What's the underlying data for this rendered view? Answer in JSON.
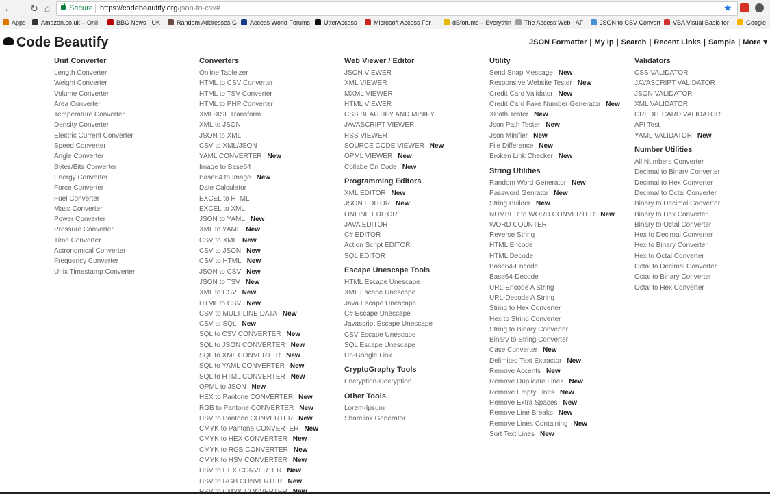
{
  "browser": {
    "secure_label": "Secure",
    "url_host": "https://codebeautify.org",
    "url_path": "/json-to-csv#",
    "bookmarks": [
      {
        "label": "Apps",
        "color": "#e37400"
      },
      {
        "label": "Amazon.co.uk – Onli",
        "color": "#333333"
      },
      {
        "label": "BBC News - UK",
        "color": "#b80000"
      },
      {
        "label": "Random Addresses G",
        "color": "#6d4c41"
      },
      {
        "label": "Access World Forums",
        "color": "#1a3a8a"
      },
      {
        "label": "UtterAccess",
        "color": "#0f0f0f"
      },
      {
        "label": "Microsoft Access For",
        "color": "#c62828"
      },
      {
        "label": "dBforums – Everythin",
        "color": "#e6b800"
      },
      {
        "label": "The Access Web - AF",
        "color": "#9e9e9e"
      },
      {
        "label": "JSON to CSV Convert",
        "color": "#4a90d9"
      },
      {
        "label": "VBA Visual Basic for",
        "color": "#d32f2f"
      },
      {
        "label": "Google",
        "color": "#f4b400"
      }
    ]
  },
  "header": {
    "logo": "Code Beautify",
    "nav": [
      "JSON Formatter",
      "My Ip",
      "Search",
      "Recent Links",
      "Sample",
      "More"
    ]
  },
  "new_badge": "New",
  "columns": [
    {
      "sections": [
        {
          "title": "Unit Converter",
          "items": [
            {
              "label": "Length Converter"
            },
            {
              "label": "Weight Converter"
            },
            {
              "label": "Volume Converter"
            },
            {
              "label": "Area Converter"
            },
            {
              "label": "Temperature Converter"
            },
            {
              "label": "Density Converter"
            },
            {
              "label": "Electric Current Converter"
            },
            {
              "label": "Speed Converter"
            },
            {
              "label": "Angle Converter"
            },
            {
              "label": "Bytes/Bits Converter"
            },
            {
              "label": "Energy Converter"
            },
            {
              "label": "Force Converter"
            },
            {
              "label": "Fuel Converter"
            },
            {
              "label": "Mass Converter"
            },
            {
              "label": "Power Converter"
            },
            {
              "label": "Pressure Converter"
            },
            {
              "label": "Time Converter"
            },
            {
              "label": "Astronomical Converter"
            },
            {
              "label": "Frequency Converter"
            },
            {
              "label": "Unix Timestamp Converter"
            }
          ]
        }
      ]
    },
    {
      "sections": [
        {
          "title": "Converters",
          "items": [
            {
              "label": "Online Tableizer"
            },
            {
              "label": "HTML to CSV Converter"
            },
            {
              "label": "HTML to TSV Converter"
            },
            {
              "label": "HTML to PHP Converter"
            },
            {
              "label": "XML-XSL Transform"
            },
            {
              "label": "XML to JSON"
            },
            {
              "label": "JSON to XML"
            },
            {
              "label": "CSV to XML/JSON"
            },
            {
              "label": "YAML CONVERTER",
              "new": true
            },
            {
              "label": "Image to Base64"
            },
            {
              "label": "Base64 to Image",
              "new": true
            },
            {
              "label": "Date Calculator"
            },
            {
              "label": "EXCEL to HTML"
            },
            {
              "label": "EXCEL to XML"
            },
            {
              "label": "JSON to YAML",
              "new": true
            },
            {
              "label": "XML to YAML",
              "new": true
            },
            {
              "label": "CSV to XML",
              "new": true
            },
            {
              "label": "CSV to JSON",
              "new": true
            },
            {
              "label": "CSV to HTML",
              "new": true
            },
            {
              "label": "JSON to CSV",
              "new": true
            },
            {
              "label": "JSON to TSV",
              "new": true
            },
            {
              "label": "XML to CSV",
              "new": true
            },
            {
              "label": "HTML to CSV",
              "new": true
            },
            {
              "label": "CSV to MULTILINE DATA",
              "new": true
            },
            {
              "label": "CSV to SQL",
              "new": true
            },
            {
              "label": "SQL to CSV CONVERTER",
              "new": true
            },
            {
              "label": "SQL to JSON CONVERTER",
              "new": true
            },
            {
              "label": "SQL to XML CONVERTER",
              "new": true
            },
            {
              "label": "SQL to YAML CONVERTER",
              "new": true
            },
            {
              "label": "SQL to HTML CONVERTER",
              "new": true
            },
            {
              "label": "OPML to JSON",
              "new": true
            },
            {
              "label": "HEX to Pantone CONVERTER",
              "new": true
            },
            {
              "label": "RGB to Pantone CONVERTER",
              "new": true
            },
            {
              "label": "HSV to Pantone CONVERTER",
              "new": true
            },
            {
              "label": "CMYK to Pantone CONVERTER",
              "new": true
            },
            {
              "label": "CMYK to HEX CONVERTER",
              "new": true
            },
            {
              "label": "CMYK to RGB CONVERTER",
              "new": true
            },
            {
              "label": "CMYK to HSV CONVERTER",
              "new": true
            },
            {
              "label": "HSV to HEX CONVERTER",
              "new": true
            },
            {
              "label": "HSV to RGB CONVERTER",
              "new": true
            },
            {
              "label": "HSV to CMYK CONVERTER",
              "new": true
            }
          ]
        }
      ]
    },
    {
      "sections": [
        {
          "title": "Web Viewer / Editor",
          "items": [
            {
              "label": "JSON VIEWER"
            },
            {
              "label": "XML VIEWER"
            },
            {
              "label": "MXML VIEWER"
            },
            {
              "label": "HTML VIEWER"
            },
            {
              "label": "CSS BEAUTIFY AND MINIFY"
            },
            {
              "label": "JAVASCRIPT VIEWER"
            },
            {
              "label": "RSS VIEWER"
            },
            {
              "label": "SOURCE CODE VIEWER",
              "new": true
            },
            {
              "label": "OPML VIEWER",
              "new": true
            },
            {
              "label": "Collabe On Code",
              "new": true
            }
          ]
        },
        {
          "title": "Programming Editors",
          "items": [
            {
              "label": "XML EDITOR",
              "new": true
            },
            {
              "label": "JSON EDITOR",
              "new": true
            },
            {
              "label": "ONLINE EDITOR"
            },
            {
              "label": "JAVA EDITOR"
            },
            {
              "label": "C# EDITOR"
            },
            {
              "label": "Action Script EDITOR"
            },
            {
              "label": "SQL EDITOR"
            }
          ]
        },
        {
          "title": "Escape Unescape Tools",
          "items": [
            {
              "label": "HTML Escape Unescape"
            },
            {
              "label": "XML Escape Unescape"
            },
            {
              "label": "Java Escape Unescape"
            },
            {
              "label": "C# Escape Unescape"
            },
            {
              "label": "Javascript Escape Unescape"
            },
            {
              "label": "CSV Escape Unescape"
            },
            {
              "label": "SQL Escape Unescape"
            },
            {
              "label": "Un-Google Link"
            }
          ]
        },
        {
          "title": "CryptoGraphy Tools",
          "items": [
            {
              "label": "Encryption-Decryption"
            }
          ]
        },
        {
          "title": "Other Tools",
          "items": [
            {
              "label": "Lorem-Ipsum"
            },
            {
              "label": "Sharelink Generator"
            }
          ]
        }
      ]
    },
    {
      "sections": [
        {
          "title": "Utility",
          "items": [
            {
              "label": "Send Snap Message",
              "new": true
            },
            {
              "label": "Responsive Website Tester",
              "new": true
            },
            {
              "label": "Credit Card Validator",
              "new": true
            },
            {
              "label": "Credit Card Fake Number Generator",
              "new": true
            },
            {
              "label": "XPath Tester",
              "new": true
            },
            {
              "label": "Json Path Tester",
              "new": true
            },
            {
              "label": "Json Minifier",
              "new": true
            },
            {
              "label": "File Difference",
              "new": true
            },
            {
              "label": "Broken Link Checker",
              "new": true
            }
          ]
        },
        {
          "title": "String Utilities",
          "items": [
            {
              "label": "Random Word Generator",
              "new": true
            },
            {
              "label": "Password Genrator",
              "new": true
            },
            {
              "label": "String Builder",
              "new": true
            },
            {
              "label": "NUMBER to WORD CONVERTER",
              "new": true
            },
            {
              "label": "WORD COUNTER"
            },
            {
              "label": "Reverse String"
            },
            {
              "label": "HTML Encode"
            },
            {
              "label": "HTML Decode"
            },
            {
              "label": "Base64-Encode"
            },
            {
              "label": "Base64-Decode"
            },
            {
              "label": "URL-Encode A String"
            },
            {
              "label": "URL-Decode A String"
            },
            {
              "label": "String to Hex Converter"
            },
            {
              "label": "Hex to String Converter"
            },
            {
              "label": "String to Binary Converter"
            },
            {
              "label": "Binary to String Converter"
            },
            {
              "label": "Case Converter",
              "new": true
            },
            {
              "label": "Delimited Text Extractor",
              "new": true
            },
            {
              "label": "Remove Accents",
              "new": true
            },
            {
              "label": "Remove Duplicate Lines",
              "new": true
            },
            {
              "label": "Remove Empty Lines",
              "new": true
            },
            {
              "label": "Remove Extra Spaces",
              "new": true
            },
            {
              "label": "Remove Line Breaks",
              "new": true
            },
            {
              "label": "Remove Lines Containing",
              "new": true
            },
            {
              "label": "Sort Text Lines",
              "new": true
            }
          ]
        }
      ]
    },
    {
      "sections": [
        {
          "title": "Validators",
          "items": [
            {
              "label": "CSS VALIDATOR"
            },
            {
              "label": "JAVASCRIPT VALIDATOR"
            },
            {
              "label": "JSON VALIDATOR"
            },
            {
              "label": "XML VALIDATOR"
            },
            {
              "label": "CREDIT CARD VALIDATOR"
            },
            {
              "label": "API Test"
            },
            {
              "label": "YAML VALIDATOR",
              "new": true
            }
          ]
        },
        {
          "title": "Number Utilities",
          "items": [
            {
              "label": "All Numbers Converter"
            },
            {
              "label": "Decimal to Binary Converter"
            },
            {
              "label": "Decimal to Hex Converter"
            },
            {
              "label": "Decimal to Octal Converter"
            },
            {
              "label": "Binary to Decimal Converter"
            },
            {
              "label": "Binary to Hex Converter"
            },
            {
              "label": "Binary to Octal Converter"
            },
            {
              "label": "Hex to Decimal Converter"
            },
            {
              "label": "Hex to Binary Converter"
            },
            {
              "label": "Hex to Octal Converter"
            },
            {
              "label": "Octal to Decimal Converter"
            },
            {
              "label": "Octal to Binary Converter"
            },
            {
              "label": "Octal to Hex Converter"
            }
          ]
        }
      ]
    }
  ]
}
